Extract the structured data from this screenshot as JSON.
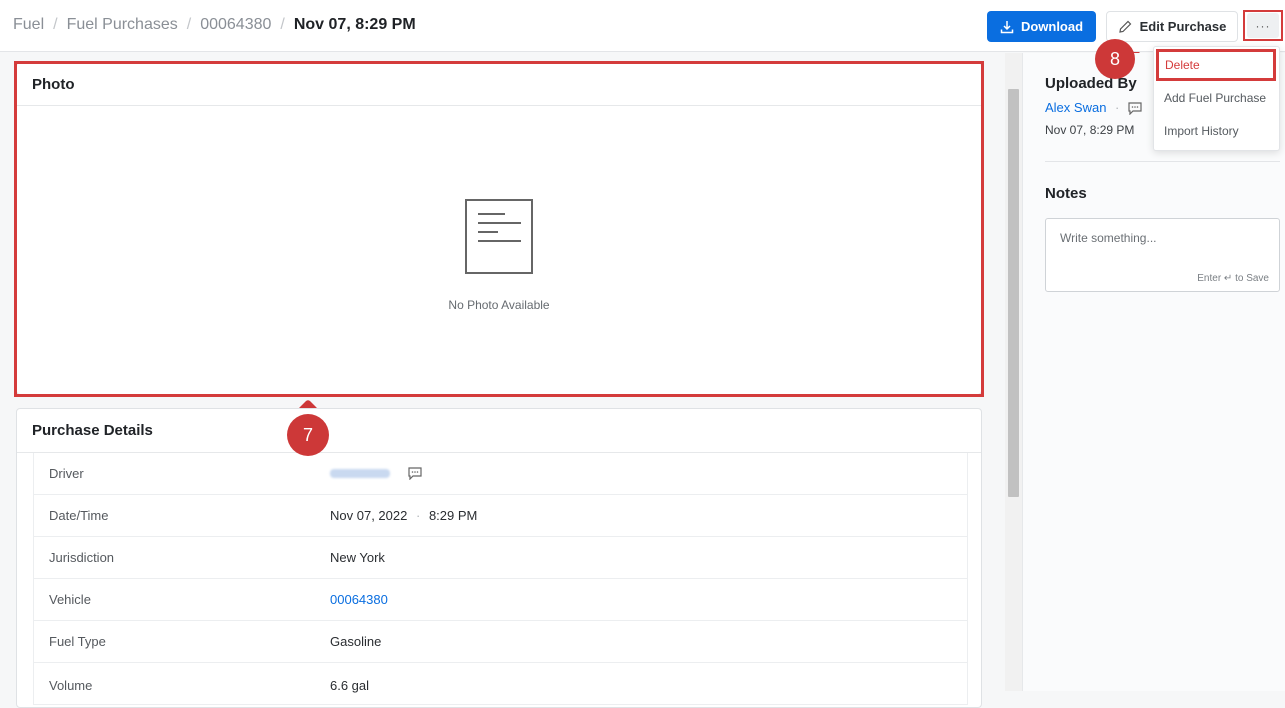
{
  "breadcrumb": {
    "items": [
      "Fuel",
      "Fuel Purchases",
      "00064380"
    ],
    "current": "Nov 07, 8:29 PM"
  },
  "toolbar": {
    "download_label": "Download",
    "edit_label": "Edit Purchase",
    "more_label": "···"
  },
  "photo": {
    "title": "Photo",
    "empty_text": "No Photo Available"
  },
  "purchase_details": {
    "title": "Purchase Details",
    "rows": [
      {
        "label": "Driver",
        "value": ""
      },
      {
        "label": "Date/Time",
        "value": "Nov 07, 2022",
        "value_extra": "8:29 PM"
      },
      {
        "label": "Jurisdiction",
        "value": "New York"
      },
      {
        "label": "Vehicle",
        "value": "00064380"
      },
      {
        "label": "Fuel Type",
        "value": "Gasoline"
      },
      {
        "label": "Volume",
        "value": "6.6 gal"
      }
    ]
  },
  "uploaded_by": {
    "title": "Uploaded By",
    "name": "Alex Swan",
    "time": "Nov 07, 8:29 PM"
  },
  "notes": {
    "title": "Notes",
    "placeholder": "Write something...",
    "hint": "Enter ↵ to Save"
  },
  "menu": {
    "items": [
      "Delete",
      "Add Fuel Purchase",
      "Import History"
    ]
  },
  "markers": {
    "seven": "7",
    "eight": "8"
  },
  "colors": {
    "accent": "#0a6ee0",
    "highlight": "#d43b3b"
  }
}
